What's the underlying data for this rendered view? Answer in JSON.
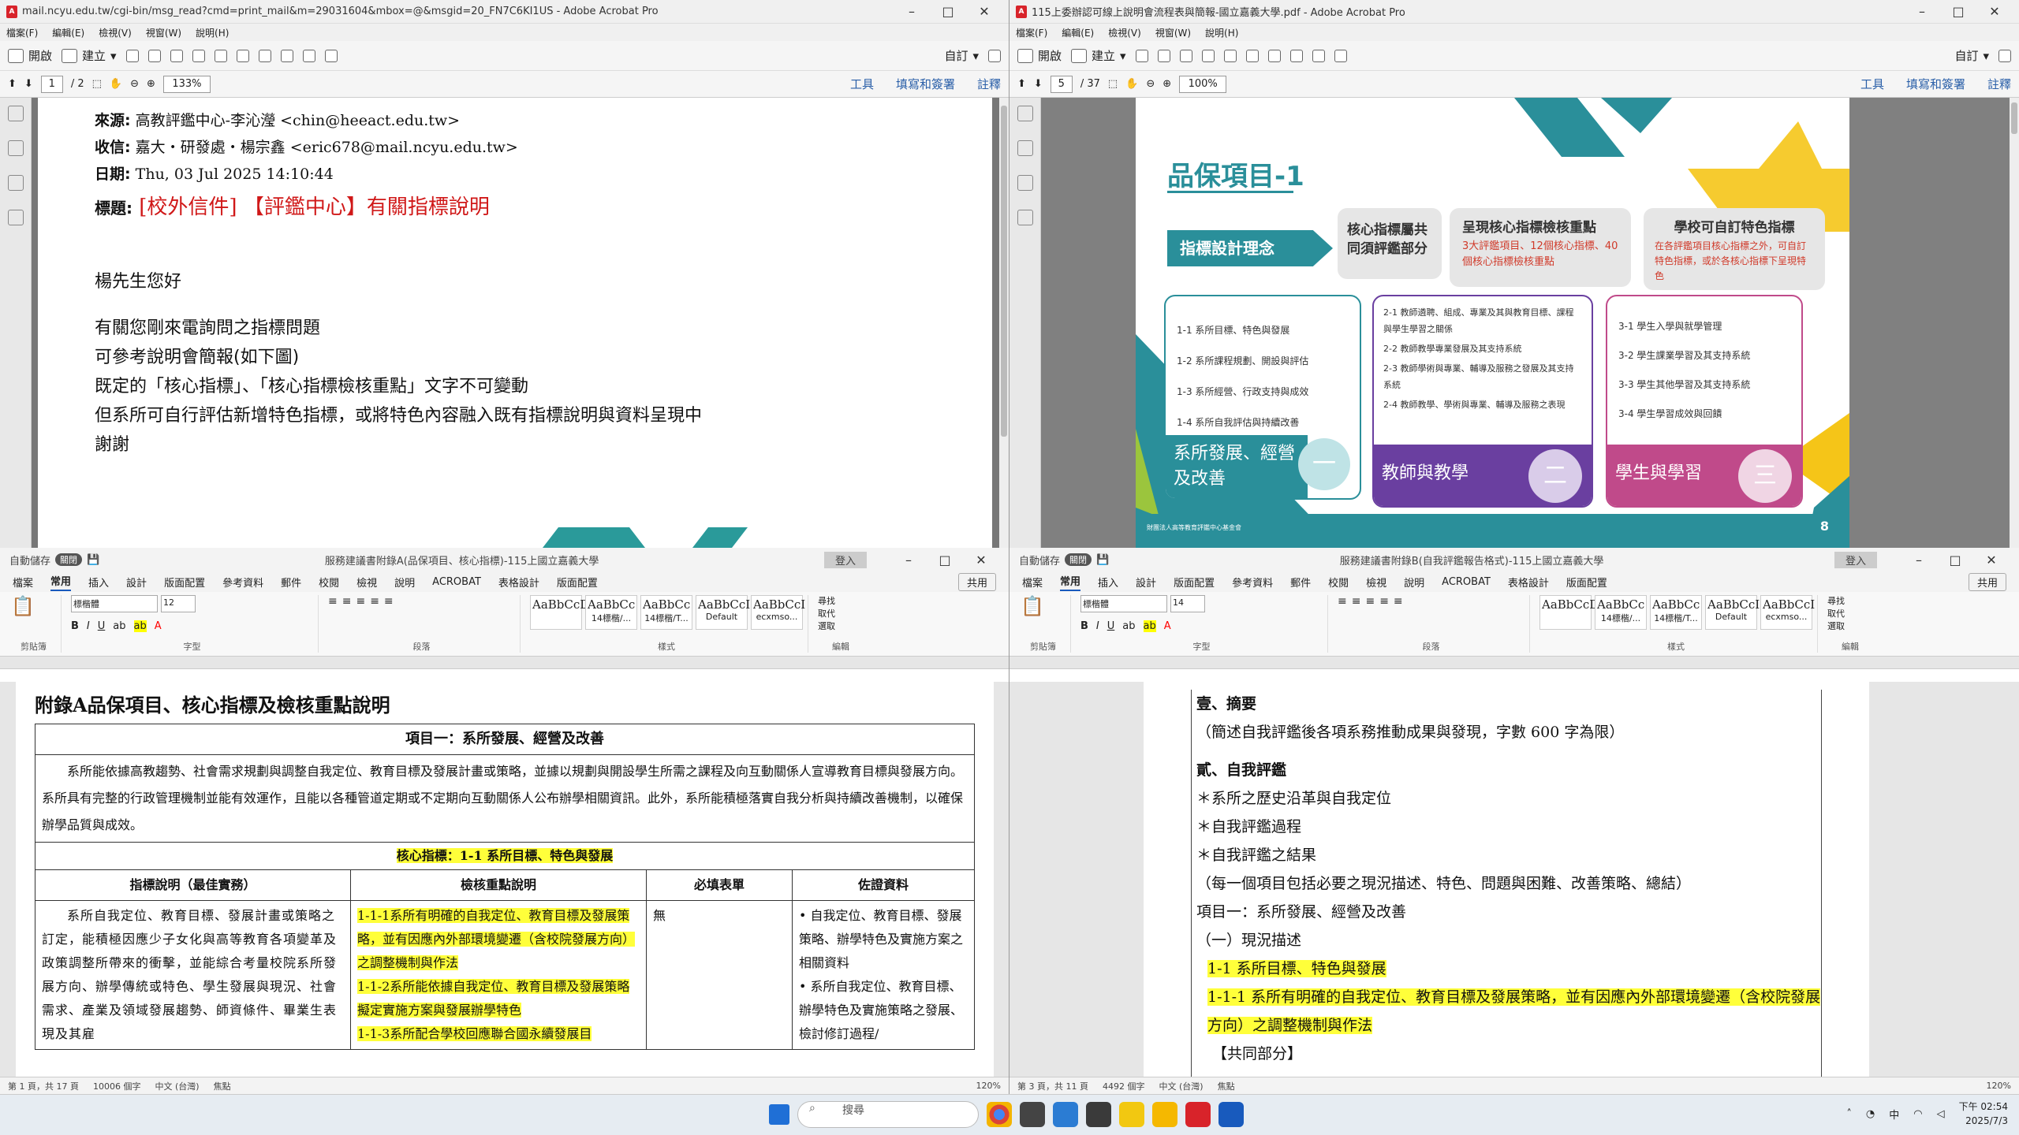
{
  "w1": {
    "title": "mail.ncyu.edu.tw/cgi-bin/msg_read?cmd=print_mail&m=29031604&mbox=@&msgid=20_FN7C6KI1US - Adobe Acrobat Pro",
    "menu": [
      "檔案(F)",
      "編輯(E)",
      "檢視(V)",
      "視窗(W)",
      "說明(H)"
    ],
    "open": "開啟",
    "create": "建立",
    "custom": "自訂",
    "page": "1",
    "pages": "/ 2",
    "zoom": "133%",
    "links": [
      "工具",
      "填寫和簽署",
      "註釋"
    ],
    "from_label": "來源:",
    "from": "高教評鑑中心-李沁瀅 <chin@heeact.edu.tw>",
    "to_label": "收信:",
    "to": "嘉大・研發處・楊宗鑫 <eric678@mail.ncyu.edu.tw>",
    "date_label": "日期:",
    "date": "Thu, 03 Jul 2025 14:10:44",
    "subj_label": "標題:",
    "subj": "[校外信件] 【評鑑中心】有關指標說明",
    "greet": "楊先生您好",
    "lines": [
      "有關您剛來電詢問之指標問題",
      "可參考說明會簡報(如下圖)",
      "既定的「核心指標」、「核心指標檢核重點」文字不可變動",
      "但系所可自行評估新增特色指標，或將特色內容融入既有指標說明與資料呈現中",
      "謝謝"
    ]
  },
  "w2": {
    "title": "115上委辦認可線上說明會流程表與簡報-國立嘉義大學.pdf - Adobe Acrobat Pro",
    "page": "5",
    "pages": "/ 37",
    "zoom": "100%",
    "slide_title": "品保項目-1",
    "concept": "指標設計理念",
    "box1": "核心指標屬共同須評鑑部分",
    "box2_t": "呈現核心指標檢核重點",
    "box2_s": "3大評鑑項目、12個核心指標、40個核心指標檢核重點",
    "box3_t": "學校可自訂特色指標",
    "box3_s": "在各評鑑項目核心指標之外，可自訂特色指標，或於各核心指標下呈現特色",
    "col1": [
      "1-1 系所目標、特色與發展",
      "1-2 系所課程規劃、開設與評估",
      "1-3 系所經營、行政支持與成效",
      "1-4 系所自我評估與持續改善"
    ],
    "col2": [
      "2-1 教師遴聘、組成、專業及其與教育目標、課程與學生學習之關係",
      "2-2 教師教學專業發展及其支持系統",
      "2-3 教師學術與專業、輔導及服務之發展及其支持系統",
      "2-4 教師教學、學術與專業、輔導及服務之表現"
    ],
    "col3": [
      "3-1 學生入學與就學管理",
      "3-2 學生課業學習及其支持系統",
      "3-3 學生其他學習及其支持系統",
      "3-4 學生學習成效與回饋"
    ],
    "foot1": "系所發展、經營及改善",
    "foot2": "教師與教學",
    "foot3": "學生與學習",
    "num1": "一",
    "num2": "二",
    "num3": "三",
    "pagenum": "8",
    "org": "財團法人高等教育評鑑中心基金會"
  },
  "w3": {
    "title": "服務建議書附錄A(品保項目、核心指標)-115上國立嘉義大學",
    "autosave": "自動儲存",
    "off": "關閉",
    "login": "登入",
    "tabs": [
      "檔案",
      "常用",
      "插入",
      "設計",
      "版面配置",
      "參考資料",
      "郵件",
      "校閱",
      "檢視",
      "說明",
      "ACROBAT",
      "表格設計",
      "版面配置"
    ],
    "share": "共用",
    "font": "標楷體",
    "size": "12",
    "groups": [
      "剪貼簿",
      "字型",
      "段落",
      "樣式",
      "編輯"
    ],
    "styles": [
      "AaBbCcDc",
      "AaBbCc",
      "AaBbCc",
      "AaBbCcI",
      "AaBbCcI"
    ],
    "stylenames": [
      "",
      "14標楷/...",
      "14標楷/T...",
      "Default",
      "ecxmso..."
    ],
    "edit": [
      "尋找",
      "取代",
      "選取"
    ],
    "heading": "附錄A品保項目、核心指標及檢核重點說明",
    "item": "項目一：系所發展、經營及改善",
    "intro": "系所能依據高教趨勢、社會需求規劃與調整自我定位、教育目標及發展計畫或策略，並據以規劃與開設學生所需之課程及向互動關係人宣導教育目標與發展方向。系所具有完整的行政管理機制並能有效運作，且能以各種管道定期或不定期向互動關係人公布辦學相關資訊。此外，系所能積極落實自我分析與持續改善機制，以確保辦學品質與成效。",
    "core": "核心指標：1-1 系所目標、特色與發展",
    "th": [
      "指標說明（最佳實務）",
      "檢核重點說明",
      "必填表單",
      "佐證資料"
    ],
    "desc": "系所自我定位、教育目標、發展計畫或策略之訂定，能積極因應少子女化與高等教育各項變革及政策調整所帶來的衝擊，並能綜合考量校院系所發展方向、辦學傳統或特色、學生發展與現況、社會需求、產業及領域發展趨勢、師資條件、畢業生表現及其雇",
    "chk1": "1-1-1系所有明確的自我定位、教育目標及發展策略，並有因應內外部環境變遷（含校院發展方向）之調整機制與作法",
    "chk2": "1-1-2系所能依據自我定位、教育目標及發展策略擬定實施方案與發展辦學特色",
    "chk3": "1-1-3系所配合學校回應聯合國永續發展目",
    "none": "無",
    "ev1": "自我定位、教育目標、發展策略、辦學特色及實施方案之相關資料",
    "ev2": "系所自我定位、教育目標、辦學特色及實施策略之發展、檢討修訂過程/",
    "status": [
      "第 1 頁，共 17 頁",
      "10006 個字",
      "中文 (台灣)"
    ],
    "focus": "焦點",
    "zoomv": "120%"
  },
  "w4": {
    "title": "服務建議書附錄B(自我評鑑報告格式)-115上國立嘉義大學",
    "font": "標楷體",
    "size": "14",
    "lines": [
      "壹、摘要",
      "（簡述自我評鑑後各項系務推動成果與發現，字數 600 字為限）",
      "貳、自我評鑑",
      "＊系所之歷史沿革與自我定位",
      "＊自我評鑑過程",
      "＊自我評鑑之結果",
      "（每一個項目包括必要之現況描述、特色、問題與困難、改善策略、總結）",
      "項目一：系所發展、經營及改善",
      "（一）現況描述",
      "1-1 系所目標、特色與發展",
      "1-1-1 系所有明確的自我定位、教育目標及發展策略，並有因應內外部環境變遷（含校院發展方向）之調整機制與作法",
      "【共同部分】"
    ],
    "status": [
      "第 3 頁，共 11 頁",
      "4492 個字",
      "中文 (台灣)"
    ]
  },
  "taskbar": {
    "search": "搜尋",
    "ime": "中",
    "time": "下午 02:54",
    "date": "2025/7/3"
  }
}
